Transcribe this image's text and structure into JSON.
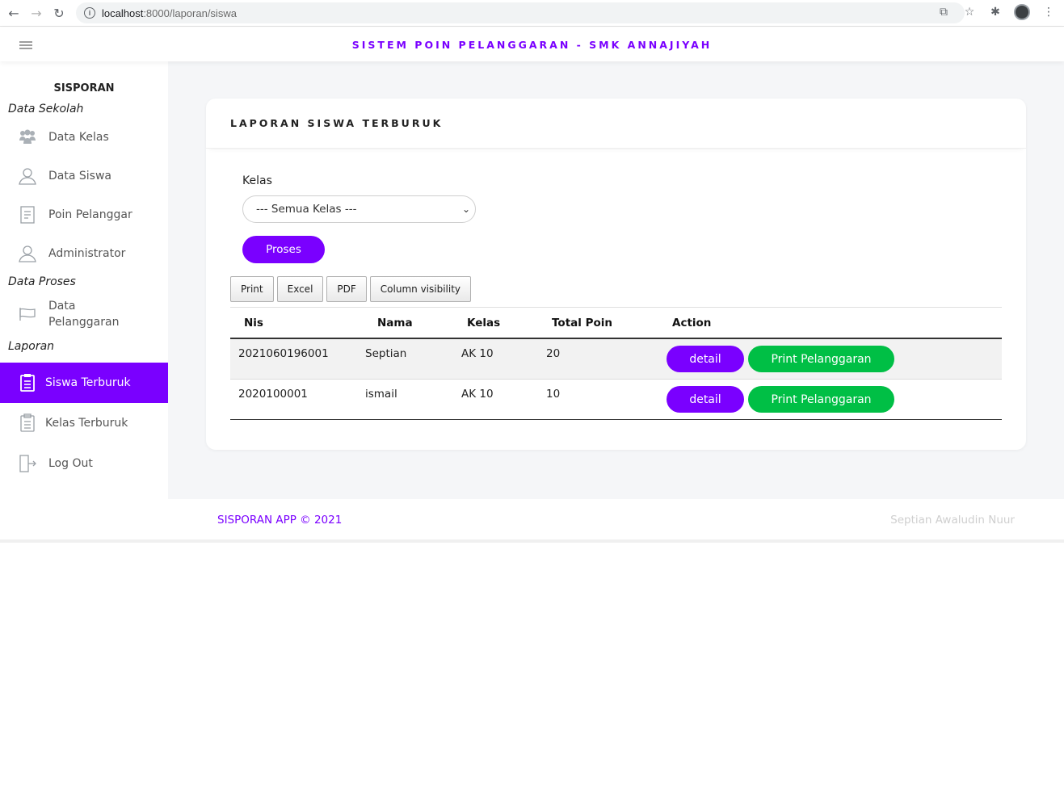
{
  "browser": {
    "url_host": "localhost",
    "url_path": ":8000/laporan/siswa"
  },
  "header": {
    "title": "SISTEM POIN PELANGGARAN - SMK ANNAJIYAH"
  },
  "sidebar": {
    "brand": "SISPORAN",
    "sections": {
      "data_sekolah": "Data Sekolah",
      "data_proses": "Data Proses",
      "laporan": "Laporan"
    },
    "items": [
      {
        "label": "Data Kelas",
        "icon": "users-icon"
      },
      {
        "label": "Data Siswa",
        "icon": "user-icon"
      },
      {
        "label": "Poin Pelanggar",
        "icon": "document-icon"
      },
      {
        "label": "Administrator",
        "icon": "user-icon"
      },
      {
        "label": "Data Pelanggaran",
        "icon": "flag-icon"
      },
      {
        "label": "Siswa Terburuk",
        "icon": "clipboard-icon",
        "active": true
      },
      {
        "label": "Kelas Terburuk",
        "icon": "clipboard-icon"
      },
      {
        "label": "Log Out",
        "icon": "logout-icon"
      }
    ]
  },
  "card": {
    "title": "LAPORAN SISWA TERBURUK",
    "kelas_label": "Kelas",
    "kelas_selected": "--- Semua Kelas ---",
    "proses_label": "Proses"
  },
  "export_buttons": [
    "Print",
    "Excel",
    "PDF",
    "Column visibility"
  ],
  "table": {
    "headers": [
      "Nis",
      "Nama",
      "Kelas",
      "Total Poin",
      "Action"
    ],
    "rows": [
      {
        "nis": "2021060196001",
        "nama": "Septian",
        "kelas": "AK 10",
        "total_poin": "20",
        "detail": "detail",
        "print": "Print Pelanggaran"
      },
      {
        "nis": "2020100001",
        "nama": "ismail",
        "kelas": "AK 10",
        "total_poin": "10",
        "detail": "detail",
        "print": "Print Pelanggaran"
      }
    ]
  },
  "footer": {
    "left": "SISPORAN APP © 2021",
    "right": "Septian Awaludin Nuur"
  },
  "colors": {
    "accent": "#7a00ff",
    "success": "#00bf45"
  }
}
